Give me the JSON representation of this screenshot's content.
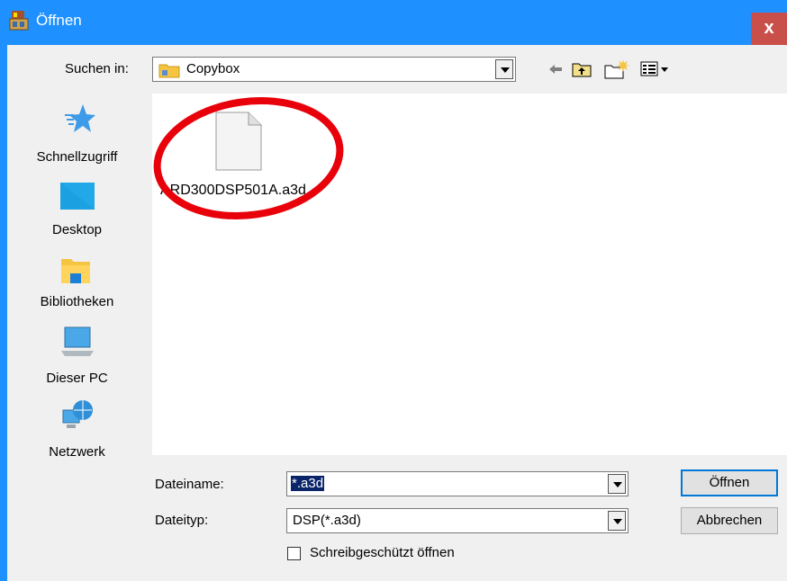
{
  "window": {
    "title": "Öffnen",
    "close_label": "x"
  },
  "lookin": {
    "label": "Suchen in:",
    "value": "Copybox"
  },
  "toolbar": {
    "icons": [
      "back-arrow-icon",
      "up-folder-icon",
      "new-folder-icon",
      "view-menu-icon"
    ]
  },
  "places": [
    {
      "label": "Schnellzugriff",
      "icon": "quick-access-star-icon"
    },
    {
      "label": "Desktop",
      "icon": "desktop-icon"
    },
    {
      "label": "Bibliotheken",
      "icon": "libraries-icon"
    },
    {
      "label": "Dieser PC",
      "icon": "this-pc-icon"
    },
    {
      "label": "Netzwerk",
      "icon": "network-icon"
    }
  ],
  "files": [
    {
      "name": "ARD300DSP501A.a3d"
    }
  ],
  "form": {
    "filename_label": "Dateiname:",
    "filename_value": "*.a3d",
    "filetype_label": "Dateityp:",
    "filetype_value": "DSP(*.a3d)",
    "readonly_label": "Schreibgeschützt öffnen"
  },
  "buttons": {
    "open": "Öffnen",
    "cancel": "Abbrechen"
  },
  "colors": {
    "titlebar": "#1e90ff",
    "close": "#c9504a",
    "highlight": "#0a246a",
    "annotation": "#e8000a"
  }
}
